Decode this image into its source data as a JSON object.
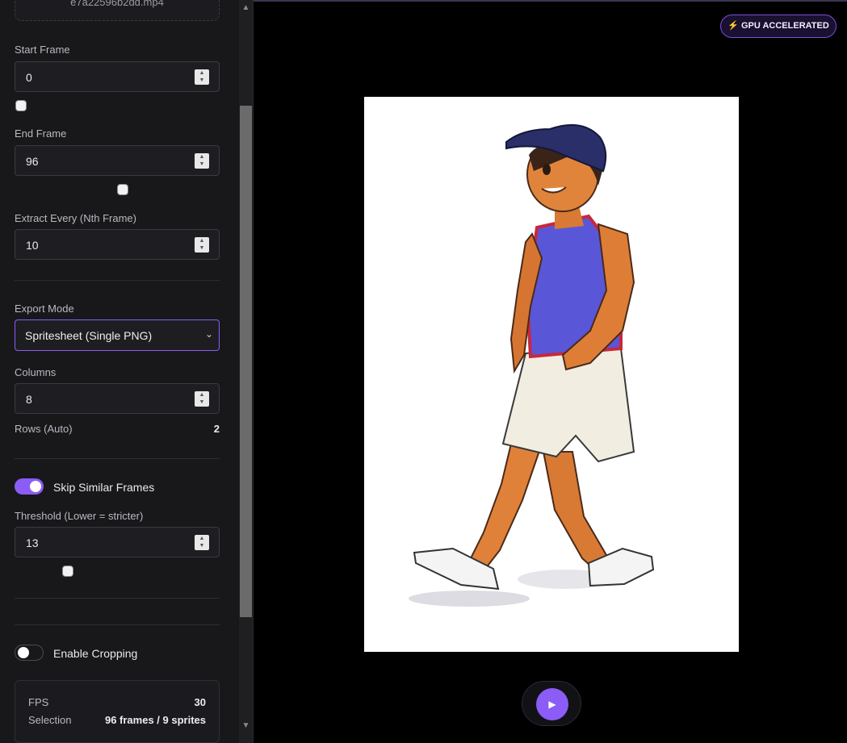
{
  "file": {
    "name": "e7a22596b2dd.mp4"
  },
  "start_frame": {
    "label": "Start Frame",
    "value": "0"
  },
  "end_frame": {
    "label": "End Frame",
    "value": "96"
  },
  "extract_every": {
    "label": "Extract Every (Nth Frame)",
    "value": "10"
  },
  "export_mode": {
    "label": "Export Mode",
    "selected": "Spritesheet (Single PNG)"
  },
  "columns": {
    "label": "Columns",
    "value": "8"
  },
  "rows": {
    "label": "Rows (Auto)",
    "value": "2"
  },
  "skip_similar": {
    "label": "Skip Similar Frames",
    "enabled": true
  },
  "threshold": {
    "label": "Threshold (Lower = stricter)",
    "value": "13"
  },
  "cropping": {
    "label": "Enable Cropping",
    "enabled": false
  },
  "stats": {
    "fps_label": "FPS",
    "fps_value": "30",
    "selection_label": "Selection",
    "selection_value": "96 frames / 9 sprites"
  },
  "badge": {
    "icon": "lightning-icon",
    "label": "GPU ACCELERATED"
  },
  "player": {
    "icon": "play-icon"
  },
  "colors": {
    "accent": "#8b5cf6",
    "sidebar_bg": "#18181b",
    "preview_bg": "#000000"
  }
}
